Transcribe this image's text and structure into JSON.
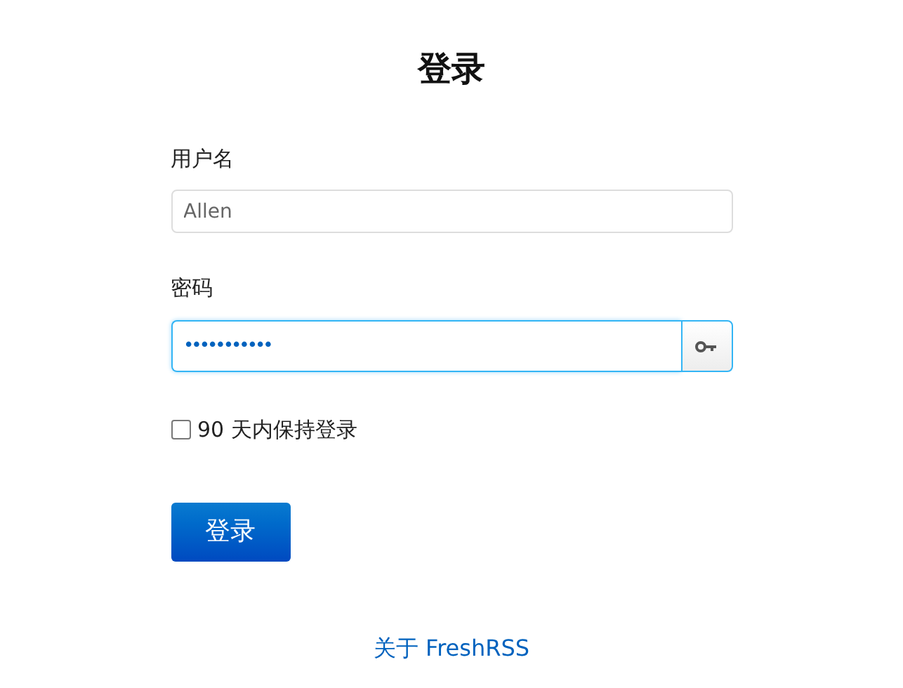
{
  "title": "登录",
  "fields": [
    {
      "label": "用户名",
      "value": "Allen",
      "focused": false,
      "kind": "text"
    },
    {
      "label": "密码",
      "value": "•••••••••••",
      "focused": true,
      "kind": "password"
    }
  ],
  "remember": {
    "label": "90 天内保持登录",
    "checked": false
  },
  "submit": "登录",
  "footer_link": "关于 FreshRSS"
}
